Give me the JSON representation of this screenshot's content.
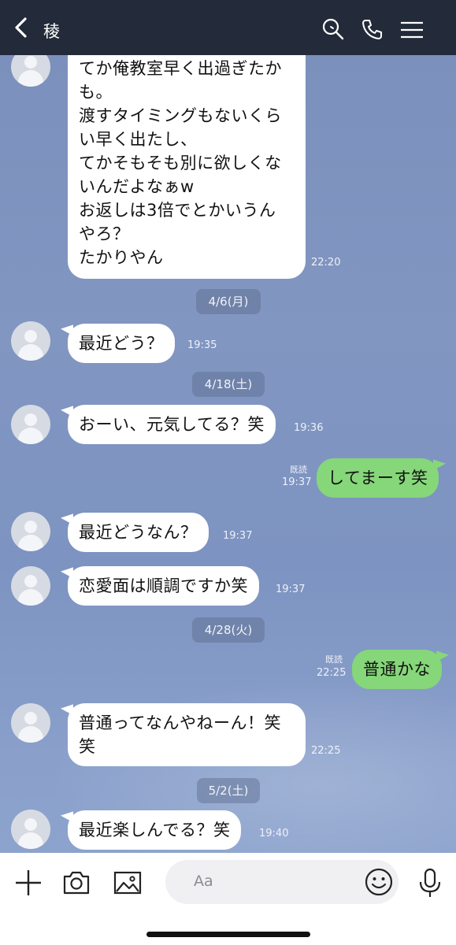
{
  "header": {
    "title": "稜",
    "icons": [
      "chevron-left-icon",
      "search-icon",
      "phone-icon",
      "menu-icon"
    ],
    "background": "#232b3a"
  },
  "colors": {
    "incoming_bubble": "#ffffff",
    "outgoing_bubble": "#86d67a",
    "chat_background": "#7c93be"
  },
  "messages": [
    {
      "dir": "in",
      "text": "てか俺教室早く出過ぎたか\nも。\n渡すタイミングもないくら\nい早く出たし、\nてかそもそも別に欲しくな\nいんだよなぁw\nお返しは3倍でとかいうん\nやろ？\nたかりやん",
      "time": "22:20"
    },
    {
      "date": "4/6(月)"
    },
    {
      "dir": "in",
      "text": "最近どう？",
      "time": "19:35"
    },
    {
      "date": "4/18(土)"
    },
    {
      "dir": "in",
      "text": "おーい、元気してる？笑",
      "time": "19:36"
    },
    {
      "dir": "out",
      "text": "してまーす笑",
      "time": "19:37",
      "read": "既読"
    },
    {
      "dir": "in",
      "text": "最近どうなん？",
      "time": "19:37"
    },
    {
      "dir": "in",
      "text": "恋愛面は順調ですか笑",
      "time": "19:37"
    },
    {
      "date": "4/28(火)"
    },
    {
      "dir": "out",
      "text": "普通かな",
      "time": "22:25",
      "read": "既読"
    },
    {
      "dir": "in",
      "text": "普通ってなんやねーん！笑\n笑",
      "time": "22:25"
    },
    {
      "date": "5/2(土)"
    },
    {
      "dir": "in",
      "text": "最近楽しんでる？笑",
      "time": "19:40"
    }
  ],
  "input": {
    "placeholder": "Aa"
  },
  "bottom_icons": [
    "plus-icon",
    "camera-icon",
    "image-icon",
    "emoji-icon",
    "microphone-icon"
  ]
}
